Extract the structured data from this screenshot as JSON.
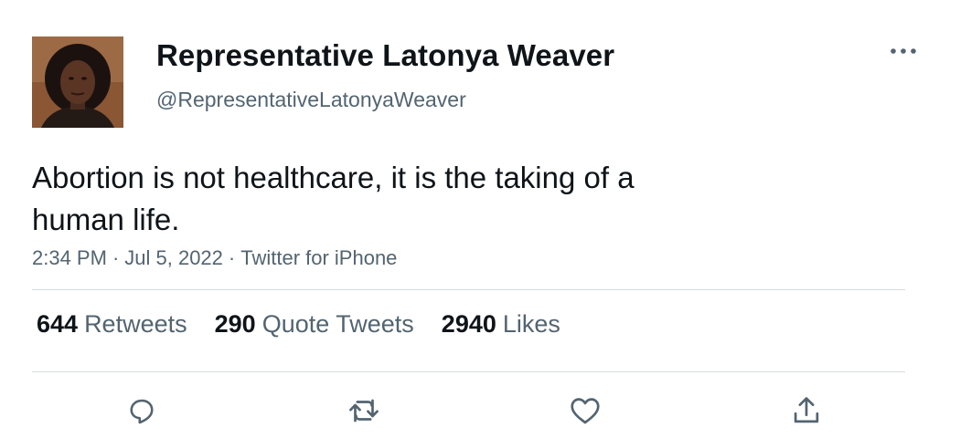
{
  "author": {
    "display_name": "Representative Latonya Weaver",
    "handle": "@RepresentativeLatonyaWeaver",
    "avatar_icon": "profile-photo"
  },
  "tweet": {
    "text_line1": "Abortion is not healthcare, it is the taking of a",
    "text_line2": "human life.",
    "time": "2:34 PM",
    "date": "Jul 5, 2022",
    "source": "Twitter for iPhone",
    "separator": "·"
  },
  "stats": {
    "retweets_count": "644",
    "retweets_label": "Retweets",
    "quote_count": "290",
    "quote_label": "Quote Tweets",
    "likes_count": "2940",
    "likes_label": "Likes"
  },
  "actions": {
    "reply_icon": "reply-icon",
    "retweet_icon": "retweet-icon",
    "like_icon": "like-icon",
    "share_icon": "share-icon",
    "more_icon": "more-icon"
  },
  "colors": {
    "text_primary": "#0f1419",
    "text_secondary": "#536471",
    "divider": "#d9dde1",
    "icon": "#536471"
  }
}
